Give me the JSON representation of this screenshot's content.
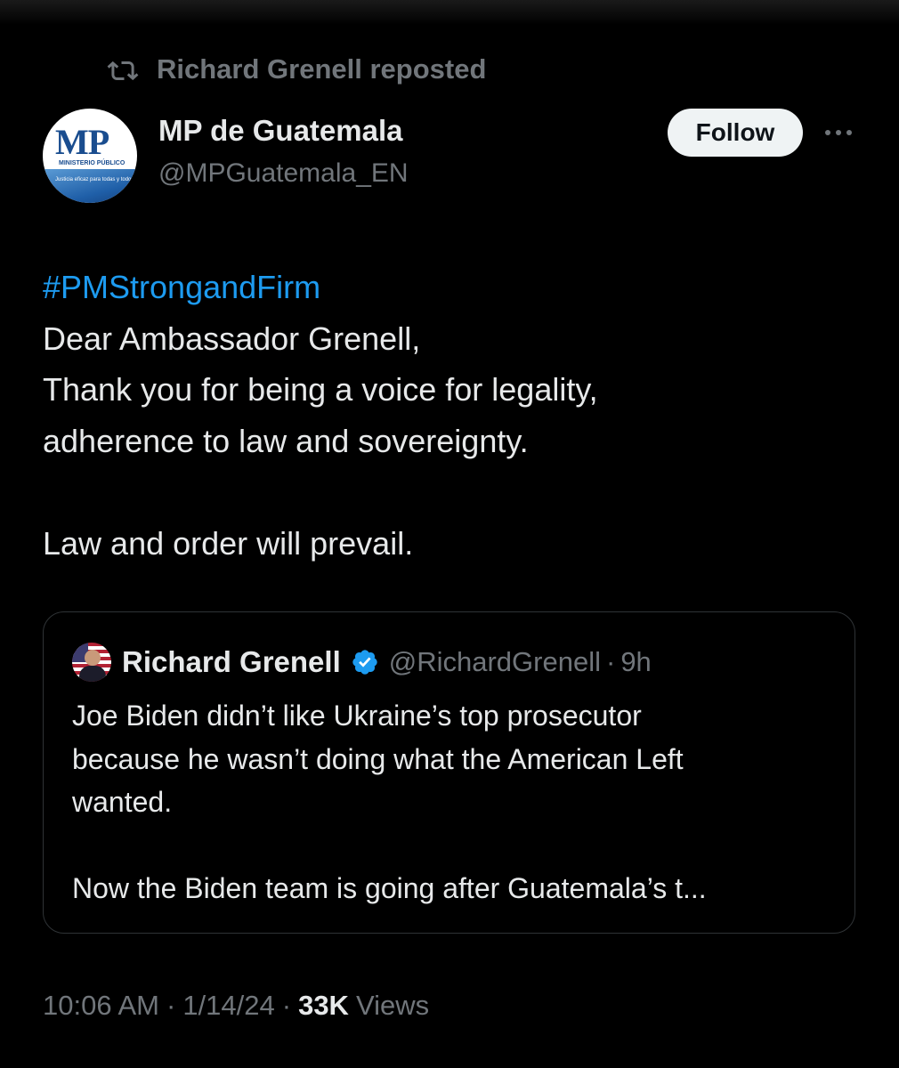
{
  "repost": {
    "icon": "repost-icon",
    "text": "Richard Grenell reposted"
  },
  "author": {
    "name": "MP de Guatemala",
    "handle": "@MPGuatemala_EN",
    "avatar_logo": "MP",
    "avatar_subtitle": "MINISTERIO PÚBLICO",
    "avatar_tagline": "Justicia eficaz para todas y todos"
  },
  "actions": {
    "follow_label": "Follow",
    "more_icon": "more-horizontal-icon"
  },
  "tweet": {
    "hashtag": "#PMStrongandFirm",
    "lines": [
      "Dear Ambassador Grenell,",
      "Thank you for being a voice for legality,",
      "adherence to law and sovereignty.",
      "",
      "Law and order will prevail."
    ]
  },
  "quote": {
    "name": "Richard Grenell",
    "verified_icon": "verified-badge-icon",
    "handle": "@RichardGrenell",
    "dot": "·",
    "time": "9h",
    "lines": [
      "Joe Biden didn’t like Ukraine’s top prosecutor",
      "because he wasn’t doing what the American Left",
      "wanted.",
      "",
      "Now the Biden team is going after Guatemala’s t..."
    ]
  },
  "meta": {
    "time": "10:06 AM",
    "sep1": "·",
    "date": "1/14/24",
    "sep2": "·",
    "views_count": "33K",
    "views_label": "Views"
  },
  "colors": {
    "background": "#000000",
    "text_primary": "#e7e9ea",
    "text_secondary": "#71767b",
    "link": "#1d9bf0",
    "verified": "#1d9bf0",
    "border": "#2f3336",
    "follow_bg": "#eff3f4"
  }
}
